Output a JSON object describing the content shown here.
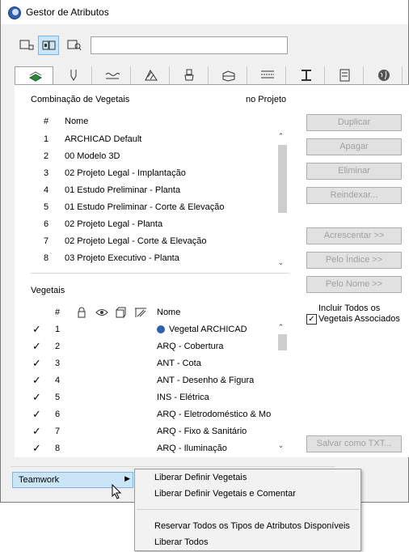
{
  "window": {
    "title": "Gestor de Atributos"
  },
  "toolbar": {
    "view_buttons": [
      "single-list-view-icon",
      "dual-list-view-icon",
      "details-view-icon"
    ],
    "search_value": ""
  },
  "tabs": [
    "vegetation-icon",
    "pen-icon",
    "line-type-icon",
    "fill-icon",
    "material-icon",
    "building-material-icon",
    "zone-icon",
    "profile-icon",
    "document-icon",
    "globe-icon"
  ],
  "combinations": {
    "label": "Combinação de Vegetais",
    "project_label": "no Projeto",
    "columns": [
      "#",
      "Nome"
    ],
    "rows": [
      {
        "n": "1",
        "name": "ARCHICAD Default"
      },
      {
        "n": "2",
        "name": "00 Modelo 3D"
      },
      {
        "n": "3",
        "name": "02 Projeto Legal - Implantação"
      },
      {
        "n": "4",
        "name": "01 Estudo Preliminar - Planta"
      },
      {
        "n": "5",
        "name": "01 Estudo Preliminar - Corte & Elevação"
      },
      {
        "n": "6",
        "name": "02 Projeto Legal - Planta"
      },
      {
        "n": "7",
        "name": "02 Projeto Legal - Corte & Elevação"
      },
      {
        "n": "8",
        "name": "03 Projeto Executivo - Planta"
      }
    ]
  },
  "layers": {
    "label": "Vegetais",
    "columns": [
      "#",
      "Nome"
    ],
    "column_icons": [
      "lock-icon",
      "eye-icon",
      "wireframe-icon",
      "intersection-icon"
    ],
    "rows": [
      {
        "n": "1",
        "name": "Vegetal ARCHICAD"
      },
      {
        "n": "2",
        "name": "ARQ - Cobertura"
      },
      {
        "n": "3",
        "name": "ANT - Cota"
      },
      {
        "n": "4",
        "name": "ANT - Desenho & Figura"
      },
      {
        "n": "5",
        "name": "INS - Elétrica"
      },
      {
        "n": "6",
        "name": "ARQ - Eletrodoméstico & Mo"
      },
      {
        "n": "7",
        "name": "ARQ - Fixo & Sanitário"
      },
      {
        "n": "8",
        "name": "ARQ - Iluminação"
      }
    ]
  },
  "buttons": {
    "duplicar": "Duplicar",
    "apagar": "Apagar",
    "eliminar": "Eliminar",
    "reindexar": "Reindexar...",
    "acrescentar": "Acrescentar >>",
    "pelo_indice": "Pelo Índice >>",
    "pelo_nome": "Pelo Nome >>",
    "salvar_txt": "Salvar como TXT..."
  },
  "include_all": {
    "line1": "Incluir Todos os",
    "line2": "Vegetais Associados",
    "checked": true
  },
  "teamwork": {
    "label": "Teamwork"
  },
  "context_menu": {
    "items": [
      "Liberar Definir Vegetais",
      "Liberar Definir Vegetais e Comentar",
      "Reservar Todos os Tipos de Atributos Disponíveis",
      "Liberar Todos"
    ]
  },
  "colors": {
    "accent": "#cce4f7",
    "accent_border": "#7eb4ea",
    "disabled_text": "#a0a0a0"
  }
}
